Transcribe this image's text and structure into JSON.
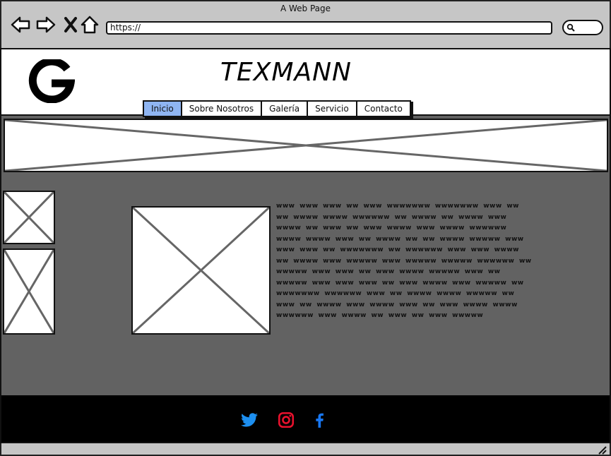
{
  "window": {
    "title": "A Web Page"
  },
  "browser": {
    "url": "https://",
    "icons": [
      "back-arrow-icon",
      "forward-arrow-icon",
      "close-x-icon",
      "home-icon",
      "search-icon"
    ]
  },
  "site": {
    "brand": "TEXMANN",
    "logo_icon": "google-g-logo",
    "nav": [
      {
        "label": "Inicio",
        "active": true
      },
      {
        "label": "Sobre Nosotros",
        "active": false
      },
      {
        "label": "Galería",
        "active": false
      },
      {
        "label": "Servicio",
        "active": false
      },
      {
        "label": "Contacto",
        "active": false
      }
    ],
    "active_tab_color": "#8fb5f2"
  },
  "body_text": "ᴡᴡᴡ ᴡᴡᴡ ᴡᴡᴡ ᴡᴡ ᴡᴡᴡ ᴡᴡᴡᴡᴡᴡᴡ ᴡᴡᴡᴡᴡᴡᴡ ᴡᴡᴡ ᴡᴡ ᴡᴡ ᴡᴡᴡᴡ ᴡᴡᴡᴡ ᴡᴡᴡᴡᴡᴡ ᴡᴡ ᴡᴡᴡᴡ ᴡᴡ ᴡᴡᴡᴡ ᴡᴡᴡ ᴡᴡᴡᴡ ᴡᴡ ᴡᴡᴡ ᴡᴡ ᴡᴡᴡ ᴡᴡᴡᴡ ᴡᴡᴡ ᴡᴡᴡᴡ ᴡᴡᴡᴡᴡᴡ ᴡᴡᴡᴡ ᴡᴡᴡᴡ ᴡᴡᴡ ᴡᴡ ᴡᴡᴡᴡ ᴡᴡ ᴡᴡ ᴡᴡᴡᴡ ᴡᴡᴡᴡᴡ ᴡᴡᴡ ᴡᴡᴡ ᴡᴡᴡ ᴡᴡ ᴡᴡᴡᴡᴡᴡᴡ ᴡᴡ ᴡᴡᴡᴡᴡᴡ ᴡᴡᴡ ᴡᴡᴡ ᴡᴡᴡᴡ ᴡᴡ ᴡᴡᴡᴡ ᴡᴡᴡ ᴡᴡᴡᴡᴡ ᴡᴡᴡ ᴡᴡᴡᴡᴡ ᴡᴡᴡᴡᴡ ᴡᴡᴡᴡᴡᴡ ᴡᴡ ᴡᴡᴡᴡᴡ ᴡᴡᴡ ᴡᴡᴡ ᴡᴡ ᴡᴡᴡ ᴡᴡᴡᴡ ᴡᴡᴡᴡᴡ ᴡᴡᴡ ᴡᴡ ᴡᴡᴡᴡᴡ ᴡᴡᴡ ᴡᴡᴡ ᴡᴡᴡ ᴡᴡ ᴡᴡᴡ ᴡᴡᴡᴡ ᴡᴡᴡ ᴡᴡᴡᴡᴡ ᴡᴡ ᴡᴡᴡᴡᴡᴡᴡ ᴡᴡᴡᴡᴡᴡ ᴡᴡᴡ ᴡᴡ ᴡᴡᴡᴡ ᴡᴡᴡᴡ ᴡᴡᴡᴡᴡ ᴡᴡ ᴡᴡᴡ ᴡᴡ ᴡᴡᴡᴡ ᴡᴡᴡ ᴡᴡᴡᴡ ᴡᴡᴡ ᴡᴡ ᴡᴡᴡ ᴡᴡᴡᴡ ᴡᴡᴡᴡ ᴡᴡᴡᴡᴡᴡ ᴡᴡᴡ ᴡᴡᴡᴡ ᴡᴡ ᴡᴡᴡ ᴡᴡ ᴡᴡᴡ ᴡᴡᴡᴡᴡ",
  "footer": {
    "social": [
      {
        "icon": "twitter-icon",
        "color": "#1d8ff0"
      },
      {
        "icon": "instagram-icon",
        "color": "#e8112d"
      },
      {
        "icon": "facebook-icon",
        "color": "#1877f2"
      }
    ]
  }
}
